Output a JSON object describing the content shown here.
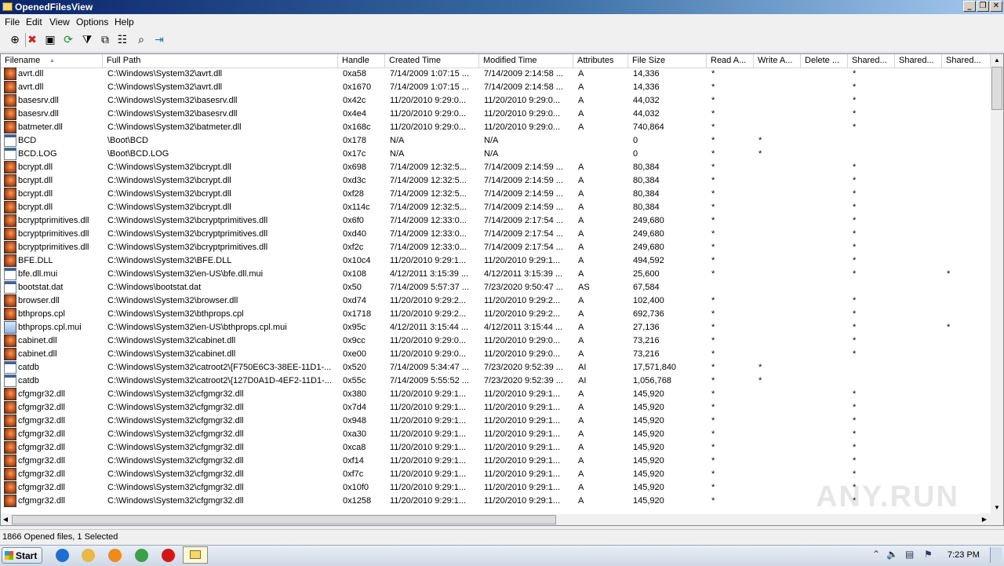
{
  "window": {
    "title": "OpenedFilesView",
    "controls": [
      "_",
      "❐",
      "✕"
    ]
  },
  "menu": [
    "File",
    "Edit",
    "View",
    "Options",
    "Help"
  ],
  "toolbar": [
    {
      "icon": "properties-target-icon",
      "glyph": "⊕"
    },
    {
      "icon": "close-handle-icon",
      "glyph": "✖",
      "color": "#cc2020"
    },
    {
      "icon": "save-icon",
      "glyph": "▣"
    },
    {
      "icon": "refresh-icon",
      "glyph": "⟳",
      "color": "#1a8f2a"
    },
    {
      "icon": "filter-icon",
      "glyph": "⧩"
    },
    {
      "icon": "copy-icon",
      "glyph": "⧉"
    },
    {
      "icon": "properties-icon",
      "glyph": "☷"
    },
    {
      "icon": "find-icon",
      "glyph": "⌕"
    },
    {
      "icon": "exit-icon",
      "glyph": "⇥",
      "color": "#1a7fa0"
    }
  ],
  "columns": [
    "Filename",
    "Full Path",
    "Handle",
    "Created Time",
    "Modified Time",
    "Attributes",
    "File Size",
    "Read A...",
    "Write A...",
    "Delete ...",
    "Shared...",
    "Shared...",
    "Shared..."
  ],
  "rows": [
    {
      "icon": "dll",
      "filename": "avrt.dll",
      "path": "C:\\Windows\\System32\\avrt.dll",
      "handle": "0xa58",
      "created": "7/14/2009 1:07:15 ...",
      "modified": "7/14/2009 2:14:58 ...",
      "attr": "A",
      "size": "14,336",
      "read": "*",
      "write": "",
      "delete": "",
      "shared1": "*",
      "shared2": "",
      "shared3": ""
    },
    {
      "icon": "dll",
      "filename": "avrt.dll",
      "path": "C:\\Windows\\System32\\avrt.dll",
      "handle": "0x1670",
      "created": "7/14/2009 1:07:15 ...",
      "modified": "7/14/2009 2:14:58 ...",
      "attr": "A",
      "size": "14,336",
      "read": "*",
      "write": "",
      "delete": "",
      "shared1": "*",
      "shared2": "",
      "shared3": ""
    },
    {
      "icon": "dll",
      "filename": "basesrv.dll",
      "path": "C:\\Windows\\System32\\basesrv.dll",
      "handle": "0x42c",
      "created": "11/20/2010 9:29:0...",
      "modified": "11/20/2010 9:29:0...",
      "attr": "A",
      "size": "44,032",
      "read": "*",
      "write": "",
      "delete": "",
      "shared1": "*",
      "shared2": "",
      "shared3": ""
    },
    {
      "icon": "dll",
      "filename": "basesrv.dll",
      "path": "C:\\Windows\\System32\\basesrv.dll",
      "handle": "0x4e4",
      "created": "11/20/2010 9:29:0...",
      "modified": "11/20/2010 9:29:0...",
      "attr": "A",
      "size": "44,032",
      "read": "*",
      "write": "",
      "delete": "",
      "shared1": "*",
      "shared2": "",
      "shared3": ""
    },
    {
      "icon": "dll",
      "filename": "batmeter.dll",
      "path": "C:\\Windows\\System32\\batmeter.dll",
      "handle": "0x168c",
      "created": "11/20/2010 9:29:0...",
      "modified": "11/20/2010 9:29:0...",
      "attr": "A",
      "size": "740,864",
      "read": "*",
      "write": "",
      "delete": "",
      "shared1": "*",
      "shared2": "",
      "shared3": ""
    },
    {
      "icon": "file",
      "filename": "BCD",
      "path": "\\Boot\\BCD",
      "handle": "0x178",
      "created": "N/A",
      "modified": "N/A",
      "attr": "",
      "size": "0",
      "read": "*",
      "write": "*",
      "delete": "",
      "shared1": "",
      "shared2": "",
      "shared3": ""
    },
    {
      "icon": "file",
      "filename": "BCD.LOG",
      "path": "\\Boot\\BCD.LOG",
      "handle": "0x17c",
      "created": "N/A",
      "modified": "N/A",
      "attr": "",
      "size": "0",
      "read": "*",
      "write": "*",
      "delete": "",
      "shared1": "",
      "shared2": "",
      "shared3": ""
    },
    {
      "icon": "dll",
      "filename": "bcrypt.dll",
      "path": "C:\\Windows\\System32\\bcrypt.dll",
      "handle": "0x698",
      "created": "7/14/2009 12:32:5...",
      "modified": "7/14/2009 2:14:59 ...",
      "attr": "A",
      "size": "80,384",
      "read": "*",
      "write": "",
      "delete": "",
      "shared1": "*",
      "shared2": "",
      "shared3": ""
    },
    {
      "icon": "dll",
      "filename": "bcrypt.dll",
      "path": "C:\\Windows\\System32\\bcrypt.dll",
      "handle": "0xd3c",
      "created": "7/14/2009 12:32:5...",
      "modified": "7/14/2009 2:14:59 ...",
      "attr": "A",
      "size": "80,384",
      "read": "*",
      "write": "",
      "delete": "",
      "shared1": "*",
      "shared2": "",
      "shared3": ""
    },
    {
      "icon": "dll",
      "filename": "bcrypt.dll",
      "path": "C:\\Windows\\System32\\bcrypt.dll",
      "handle": "0xf28",
      "created": "7/14/2009 12:32:5...",
      "modified": "7/14/2009 2:14:59 ...",
      "attr": "A",
      "size": "80,384",
      "read": "*",
      "write": "",
      "delete": "",
      "shared1": "*",
      "shared2": "",
      "shared3": ""
    },
    {
      "icon": "dll",
      "filename": "bcrypt.dll",
      "path": "C:\\Windows\\System32\\bcrypt.dll",
      "handle": "0x114c",
      "created": "7/14/2009 12:32:5...",
      "modified": "7/14/2009 2:14:59 ...",
      "attr": "A",
      "size": "80,384",
      "read": "*",
      "write": "",
      "delete": "",
      "shared1": "*",
      "shared2": "",
      "shared3": ""
    },
    {
      "icon": "dll",
      "filename": "bcryptprimitives.dll",
      "path": "C:\\Windows\\System32\\bcryptprimitives.dll",
      "handle": "0x6f0",
      "created": "7/14/2009 12:33:0...",
      "modified": "7/14/2009 2:17:54 ...",
      "attr": "A",
      "size": "249,680",
      "read": "*",
      "write": "",
      "delete": "",
      "shared1": "*",
      "shared2": "",
      "shared3": ""
    },
    {
      "icon": "dll",
      "filename": "bcryptprimitives.dll",
      "path": "C:\\Windows\\System32\\bcryptprimitives.dll",
      "handle": "0xd40",
      "created": "7/14/2009 12:33:0...",
      "modified": "7/14/2009 2:17:54 ...",
      "attr": "A",
      "size": "249,680",
      "read": "*",
      "write": "",
      "delete": "",
      "shared1": "*",
      "shared2": "",
      "shared3": ""
    },
    {
      "icon": "dll",
      "filename": "bcryptprimitives.dll",
      "path": "C:\\Windows\\System32\\bcryptprimitives.dll",
      "handle": "0xf2c",
      "created": "7/14/2009 12:33:0...",
      "modified": "7/14/2009 2:17:54 ...",
      "attr": "A",
      "size": "249,680",
      "read": "*",
      "write": "",
      "delete": "",
      "shared1": "*",
      "shared2": "",
      "shared3": ""
    },
    {
      "icon": "dll",
      "filename": "BFE.DLL",
      "path": "C:\\Windows\\System32\\BFE.DLL",
      "handle": "0x10c4",
      "created": "11/20/2010 9:29:1...",
      "modified": "11/20/2010 9:29:1...",
      "attr": "A",
      "size": "494,592",
      "read": "*",
      "write": "",
      "delete": "",
      "shared1": "*",
      "shared2": "",
      "shared3": ""
    },
    {
      "icon": "file",
      "filename": "bfe.dll.mui",
      "path": "C:\\Windows\\System32\\en-US\\bfe.dll.mui",
      "handle": "0x108",
      "created": "4/12/2011 3:15:39 ...",
      "modified": "4/12/2011 3:15:39 ...",
      "attr": "A",
      "size": "25,600",
      "read": "*",
      "write": "",
      "delete": "",
      "shared1": "*",
      "shared2": "",
      "shared3": "*"
    },
    {
      "icon": "file",
      "filename": "bootstat.dat",
      "path": "C:\\Windows\\bootstat.dat",
      "handle": "0x50",
      "created": "7/14/2009 5:57:37 ...",
      "modified": "7/23/2020 9:50:47 ...",
      "attr": "AS",
      "size": "67,584",
      "read": "",
      "write": "",
      "delete": "",
      "shared1": "",
      "shared2": "",
      "shared3": ""
    },
    {
      "icon": "dll",
      "filename": "browser.dll",
      "path": "C:\\Windows\\System32\\browser.dll",
      "handle": "0xd74",
      "created": "11/20/2010 9:29:2...",
      "modified": "11/20/2010 9:29:2...",
      "attr": "A",
      "size": "102,400",
      "read": "*",
      "write": "",
      "delete": "",
      "shared1": "*",
      "shared2": "",
      "shared3": ""
    },
    {
      "icon": "dll",
      "filename": "bthprops.cpl",
      "path": "C:\\Windows\\System32\\bthprops.cpl",
      "handle": "0x1718",
      "created": "11/20/2010 9:29:2...",
      "modified": "11/20/2010 9:29:2...",
      "attr": "A",
      "size": "692,736",
      "read": "*",
      "write": "",
      "delete": "",
      "shared1": "*",
      "shared2": "",
      "shared3": ""
    },
    {
      "icon": "cpl",
      "filename": "bthprops.cpl.mui",
      "path": "C:\\Windows\\System32\\en-US\\bthprops.cpl.mui",
      "handle": "0x95c",
      "created": "4/12/2011 3:15:44 ...",
      "modified": "4/12/2011 3:15:44 ...",
      "attr": "A",
      "size": "27,136",
      "read": "*",
      "write": "",
      "delete": "",
      "shared1": "*",
      "shared2": "",
      "shared3": "*"
    },
    {
      "icon": "dll",
      "filename": "cabinet.dll",
      "path": "C:\\Windows\\System32\\cabinet.dll",
      "handle": "0x9cc",
      "created": "11/20/2010 9:29:0...",
      "modified": "11/20/2010 9:29:0...",
      "attr": "A",
      "size": "73,216",
      "read": "*",
      "write": "",
      "delete": "",
      "shared1": "*",
      "shared2": "",
      "shared3": ""
    },
    {
      "icon": "dll",
      "filename": "cabinet.dll",
      "path": "C:\\Windows\\System32\\cabinet.dll",
      "handle": "0xe00",
      "created": "11/20/2010 9:29:0...",
      "modified": "11/20/2010 9:29:0...",
      "attr": "A",
      "size": "73,216",
      "read": "*",
      "write": "",
      "delete": "",
      "shared1": "*",
      "shared2": "",
      "shared3": ""
    },
    {
      "icon": "file",
      "filename": "catdb",
      "path": "C:\\Windows\\System32\\catroot2\\{F750E6C3-38EE-11D1-...",
      "handle": "0x520",
      "created": "7/14/2009 5:34:47 ...",
      "modified": "7/23/2020 9:52:39 ...",
      "attr": "AI",
      "size": "17,571,840",
      "read": "*",
      "write": "*",
      "delete": "",
      "shared1": "",
      "shared2": "",
      "shared3": ""
    },
    {
      "icon": "file",
      "filename": "catdb",
      "path": "C:\\Windows\\System32\\catroot2\\{127D0A1D-4EF2-11D1-...",
      "handle": "0x55c",
      "created": "7/14/2009 5:55:52 ...",
      "modified": "7/23/2020 9:52:39 ...",
      "attr": "AI",
      "size": "1,056,768",
      "read": "*",
      "write": "*",
      "delete": "",
      "shared1": "",
      "shared2": "",
      "shared3": ""
    },
    {
      "icon": "dll",
      "filename": "cfgmgr32.dll",
      "path": "C:\\Windows\\System32\\cfgmgr32.dll",
      "handle": "0x380",
      "created": "11/20/2010 9:29:1...",
      "modified": "11/20/2010 9:29:1...",
      "attr": "A",
      "size": "145,920",
      "read": "*",
      "write": "",
      "delete": "",
      "shared1": "*",
      "shared2": "",
      "shared3": ""
    },
    {
      "icon": "dll",
      "filename": "cfgmgr32.dll",
      "path": "C:\\Windows\\System32\\cfgmgr32.dll",
      "handle": "0x7d4",
      "created": "11/20/2010 9:29:1...",
      "modified": "11/20/2010 9:29:1...",
      "attr": "A",
      "size": "145,920",
      "read": "*",
      "write": "",
      "delete": "",
      "shared1": "*",
      "shared2": "",
      "shared3": ""
    },
    {
      "icon": "dll",
      "filename": "cfgmgr32.dll",
      "path": "C:\\Windows\\System32\\cfgmgr32.dll",
      "handle": "0x948",
      "created": "11/20/2010 9:29:1...",
      "modified": "11/20/2010 9:29:1...",
      "attr": "A",
      "size": "145,920",
      "read": "*",
      "write": "",
      "delete": "",
      "shared1": "*",
      "shared2": "",
      "shared3": ""
    },
    {
      "icon": "dll",
      "filename": "cfgmgr32.dll",
      "path": "C:\\Windows\\System32\\cfgmgr32.dll",
      "handle": "0xa30",
      "created": "11/20/2010 9:29:1...",
      "modified": "11/20/2010 9:29:1...",
      "attr": "A",
      "size": "145,920",
      "read": "*",
      "write": "",
      "delete": "",
      "shared1": "*",
      "shared2": "",
      "shared3": ""
    },
    {
      "icon": "dll",
      "filename": "cfgmgr32.dll",
      "path": "C:\\Windows\\System32\\cfgmgr32.dll",
      "handle": "0xca8",
      "created": "11/20/2010 9:29:1...",
      "modified": "11/20/2010 9:29:1...",
      "attr": "A",
      "size": "145,920",
      "read": "*",
      "write": "",
      "delete": "",
      "shared1": "*",
      "shared2": "",
      "shared3": ""
    },
    {
      "icon": "dll",
      "filename": "cfgmgr32.dll",
      "path": "C:\\Windows\\System32\\cfgmgr32.dll",
      "handle": "0xf14",
      "created": "11/20/2010 9:29:1...",
      "modified": "11/20/2010 9:29:1...",
      "attr": "A",
      "size": "145,920",
      "read": "*",
      "write": "",
      "delete": "",
      "shared1": "*",
      "shared2": "",
      "shared3": ""
    },
    {
      "icon": "dll",
      "filename": "cfgmgr32.dll",
      "path": "C:\\Windows\\System32\\cfgmgr32.dll",
      "handle": "0xf7c",
      "created": "11/20/2010 9:29:1...",
      "modified": "11/20/2010 9:29:1...",
      "attr": "A",
      "size": "145,920",
      "read": "*",
      "write": "",
      "delete": "",
      "shared1": "*",
      "shared2": "",
      "shared3": ""
    },
    {
      "icon": "dll",
      "filename": "cfgmgr32.dll",
      "path": "C:\\Windows\\System32\\cfgmgr32.dll",
      "handle": "0x10f0",
      "created": "11/20/2010 9:29:1...",
      "modified": "11/20/2010 9:29:1...",
      "attr": "A",
      "size": "145,920",
      "read": "*",
      "write": "",
      "delete": "",
      "shared1": "*",
      "shared2": "",
      "shared3": ""
    },
    {
      "icon": "dll",
      "filename": "cfgmgr32.dll",
      "path": "C:\\Windows\\System32\\cfgmgr32.dll",
      "handle": "0x1258",
      "created": "11/20/2010 9:29:1...",
      "modified": "11/20/2010 9:29:1...",
      "attr": "A",
      "size": "145,920",
      "read": "*",
      "write": "",
      "delete": "",
      "shared1": "*",
      "shared2": "",
      "shared3": ""
    }
  ],
  "status": "1866 Opened files, 1 Selected",
  "taskbar": {
    "start_label": "Start",
    "pinned": [
      {
        "icon": "ie-icon",
        "color": "#1e6fd0"
      },
      {
        "icon": "explorer-icon",
        "color": "#e8b84a"
      },
      {
        "icon": "media-player-icon",
        "color": "#f08a1a"
      },
      {
        "icon": "chrome-icon",
        "color": "#3aa04a"
      },
      {
        "icon": "opera-icon",
        "color": "#d01818"
      }
    ],
    "active_app_icon": "openedfilesview-icon",
    "clock": "7:23 PM"
  },
  "watermark": "ANY.RUN"
}
